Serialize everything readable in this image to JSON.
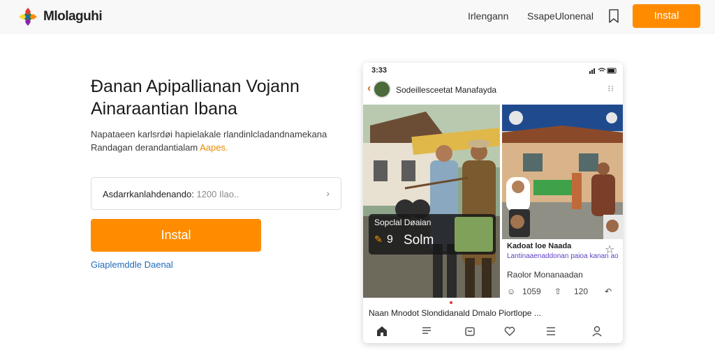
{
  "header": {
    "brand": "Mlolaguhi",
    "nav": [
      "Irlengann",
      "SsapeUlonenal"
    ],
    "install_label": "Instal"
  },
  "hero": {
    "headline": "Ðanan Apipallianan Vojann Ainaraantian Ibana",
    "desc_text": "Napataeen karlsrdøi hapielakale rlandinlcladandnamekana Randagan derandantialam",
    "desc_link": "Aapes.",
    "search_label": "Asdarrkanlahdenando:",
    "search_value": "1200 Ilao..",
    "install_label": "Instal",
    "sub_link": "Giaplemddle Daenal"
  },
  "phone": {
    "time": "3:33",
    "chat_title": "Sodeillesceetat Manafayda",
    "live_title": "Sopclal Døaian",
    "live_count": "9",
    "live_name": "Solm",
    "side_head": "Kadoat loe Naada",
    "side_sub": "Lantinaaenaddonan paioa kanan ao",
    "side_line": "Raolor Monanaadan",
    "likes": "1059",
    "shares": "120",
    "caption": "Naan  Mnodot  Slondidanald  Dmalo  Piortlope ..."
  },
  "colors": {
    "accent": "#ff8c00",
    "link_blue": "#1f6bb8",
    "link_orange": "#e88a00",
    "purple": "#5e3fc6"
  },
  "icons": [
    "logo-icon",
    "bookmark-icon",
    "chevron-right-icon",
    "back-icon",
    "more-icon",
    "star-icon",
    "comment-icon",
    "share-icon",
    "reply-icon",
    "home-icon",
    "list-icon",
    "bag-icon",
    "heart-icon",
    "menu-icon",
    "profile-icon"
  ]
}
